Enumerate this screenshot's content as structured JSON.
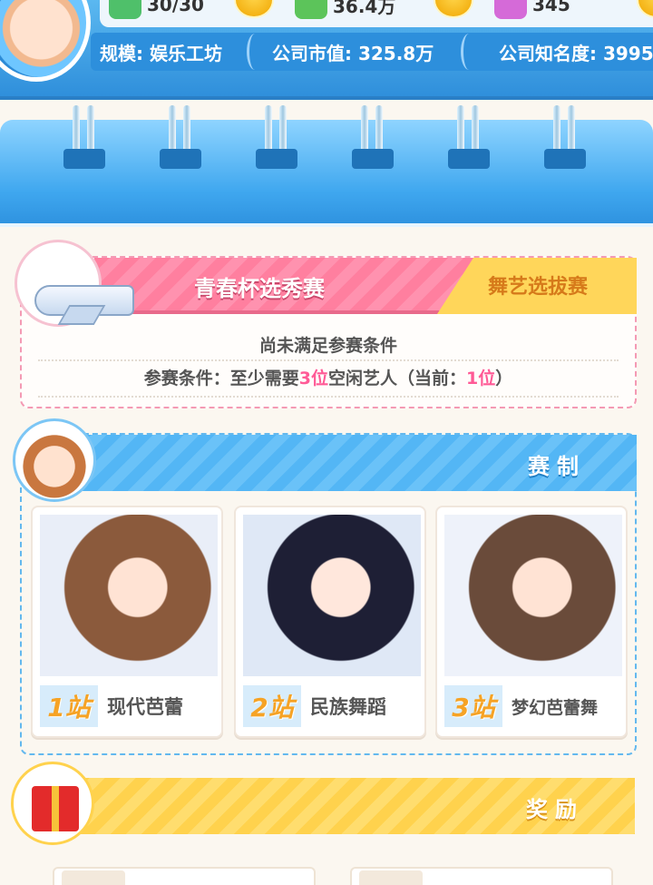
{
  "resources": [
    {
      "icon": "energy-icon",
      "value": "30/30",
      "color": "#4fc06a"
    },
    {
      "icon": "cash-icon",
      "value": "36.4万",
      "color": "#5cc45a"
    },
    {
      "icon": "gem-icon",
      "value": "345",
      "color": "#d56ad8"
    }
  ],
  "company_stats": {
    "scale": "规模: 娱乐工坊",
    "market_value": "公司市值: 325.8万",
    "fame": "公司知名度: 3995"
  },
  "contest": {
    "title": "青春杯选秀赛",
    "tag": "舞艺选拔赛",
    "status_text": "尚未满足参赛条件",
    "req_prefix": "参赛条件：至少需要",
    "req_required": "3位",
    "req_mid": "空闲艺人（当前：",
    "req_current": "1位",
    "req_suffix": "）"
  },
  "format": {
    "title": "赛制",
    "rounds": [
      {
        "no": "1站",
        "name": "现代芭蕾"
      },
      {
        "no": "2站",
        "name": "民族舞蹈"
      },
      {
        "no": "3站",
        "name": "梦幻芭蕾舞"
      }
    ]
  },
  "reward": {
    "title": "奖励"
  },
  "colors": {
    "primary_blue": "#2f8fdb",
    "pink": "#ff7f9f",
    "yellow": "#ffd24d",
    "highlight": "#ff5a96"
  }
}
